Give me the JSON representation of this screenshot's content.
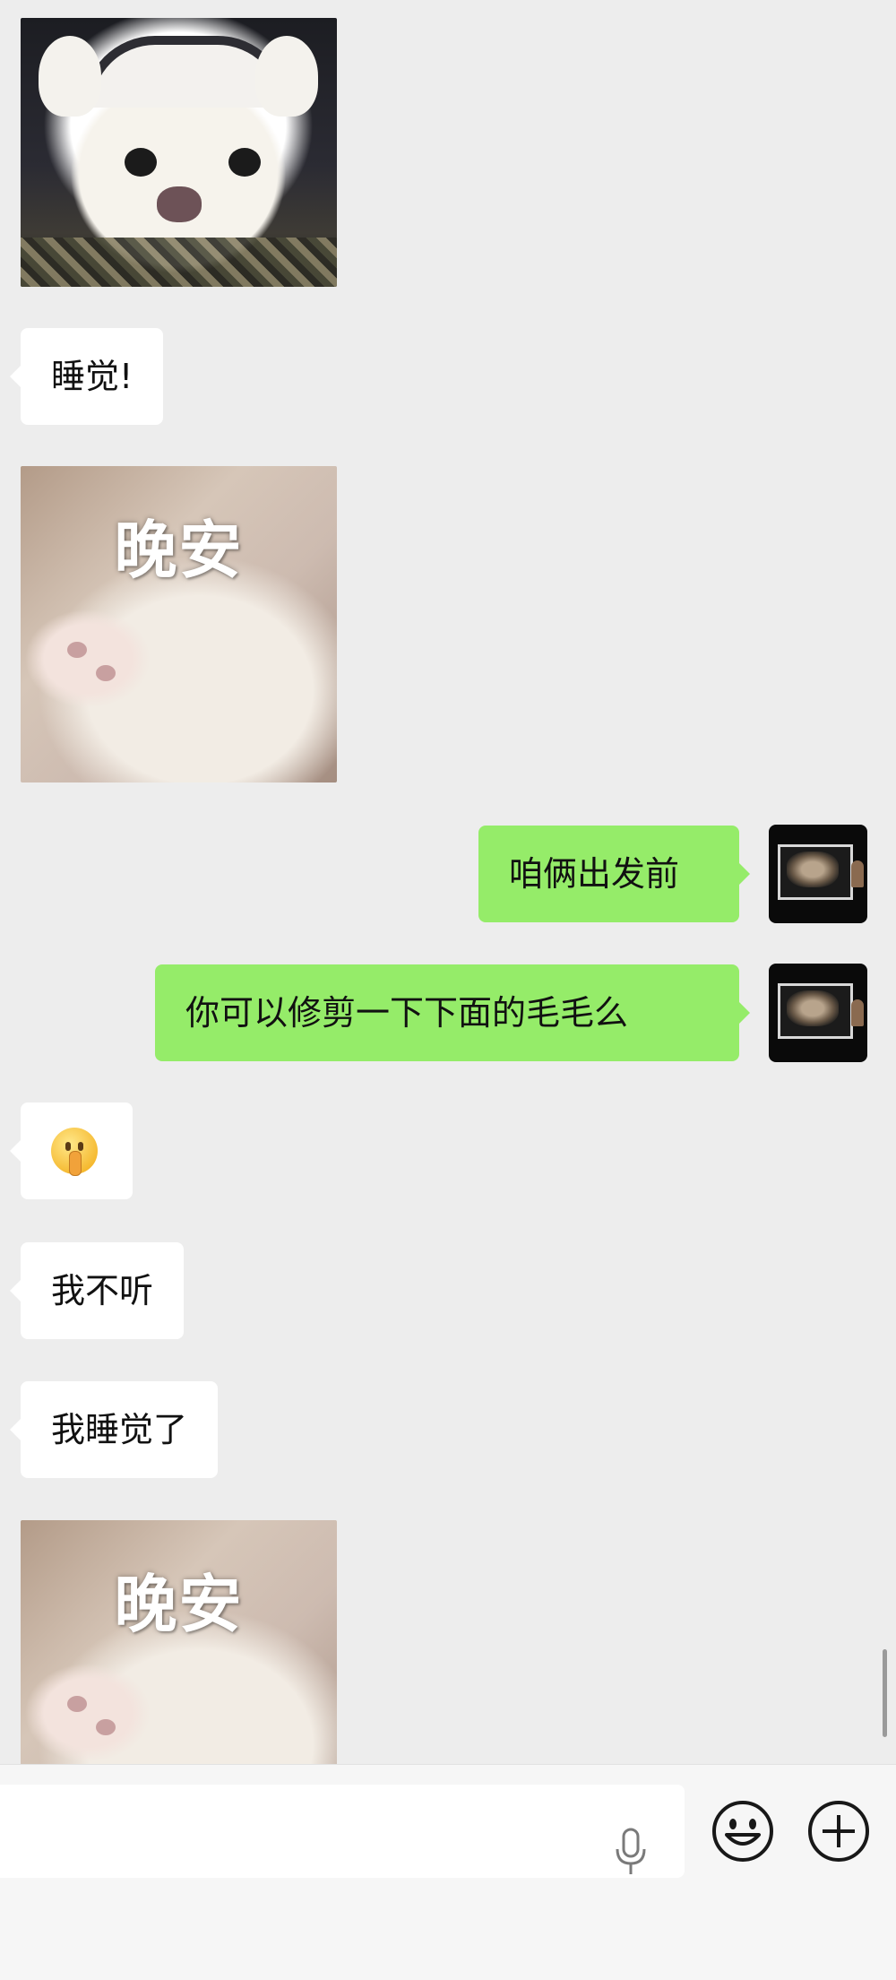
{
  "messages": {
    "sleep_text": "睡觉!",
    "sticker_caption_1": "晚安",
    "out_1": "咱俩出发前",
    "out_2": "你可以修剪一下下面的毛毛么",
    "reply_emoji": "shushing-face-emoji",
    "reply_1": "我不听",
    "reply_2": "我睡觉了",
    "sticker_caption_2": "晚安"
  },
  "colors": {
    "background": "#ededed",
    "incoming_bubble": "#ffffff",
    "outgoing_bubble": "#95ec69",
    "input_bar": "#f6f6f6"
  },
  "input_bar": {
    "text_value": "",
    "icons": [
      "microphone-icon",
      "emoji-icon",
      "plus-icon"
    ]
  }
}
